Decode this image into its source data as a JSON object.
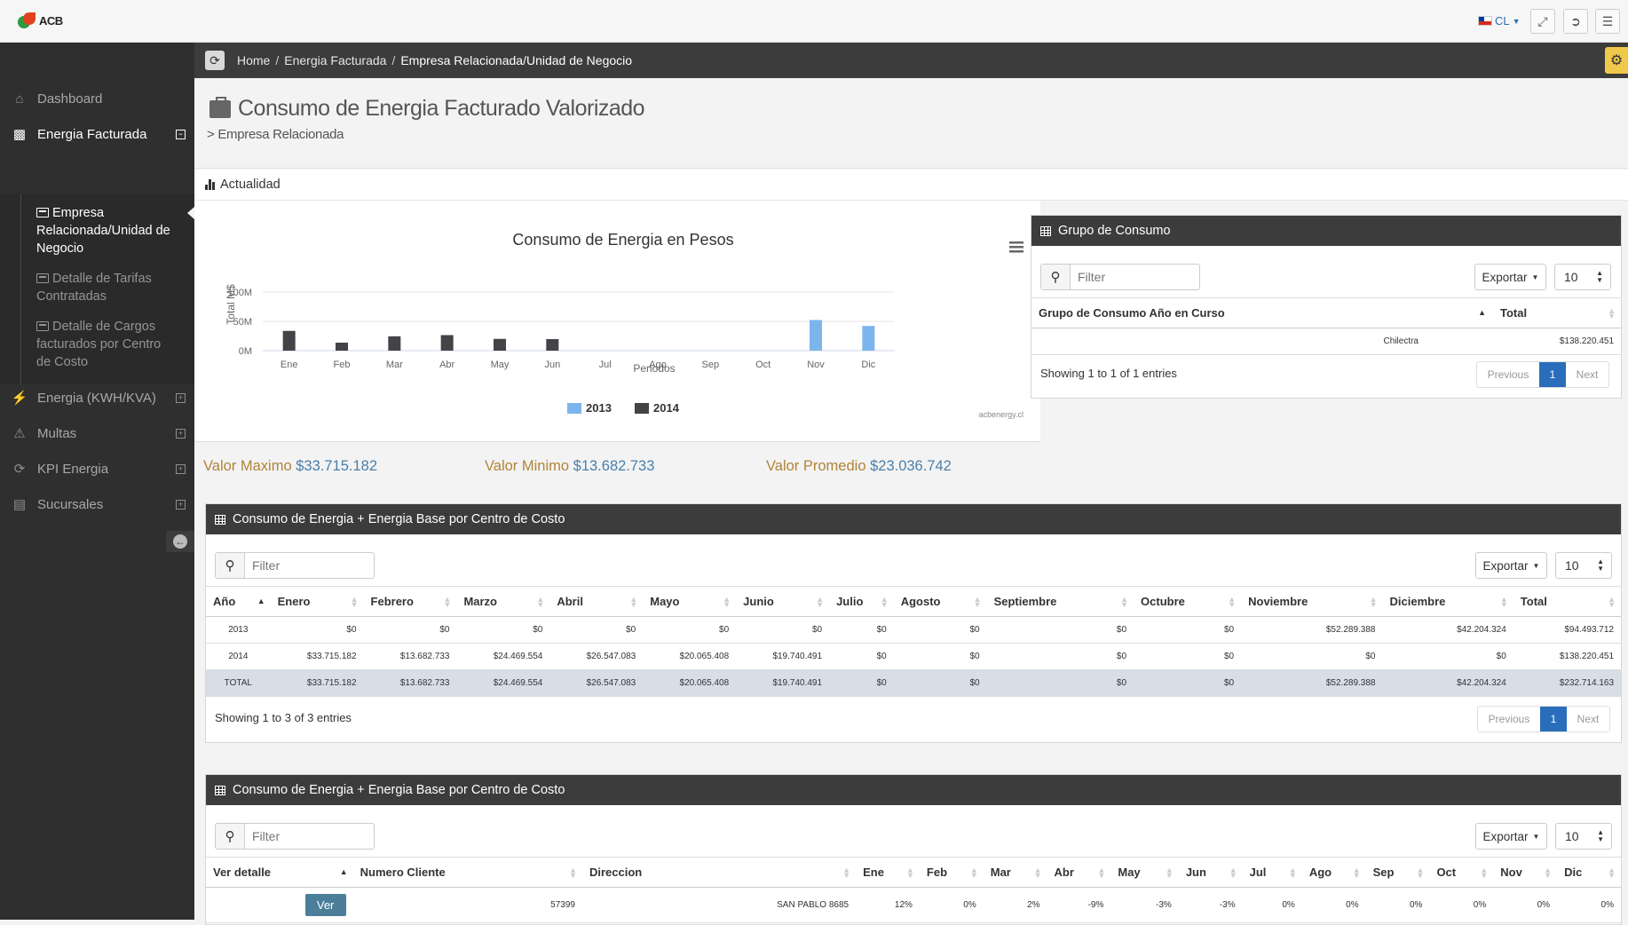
{
  "topbar": {
    "logo_text": "ACB",
    "lang": "CL"
  },
  "breadcrumb": [
    "Home",
    "Energia Facturada",
    "Empresa Relacionada/Unidad de Negocio"
  ],
  "sidebar": {
    "items": [
      {
        "label": "Dashboard",
        "icon": "home-icon"
      },
      {
        "label": "Energia Facturada",
        "icon": "bar-chart-icon"
      },
      {
        "label": "Energia (KWH/KVA)",
        "icon": "bolt-icon"
      },
      {
        "label": "Multas",
        "icon": "warning-icon"
      },
      {
        "label": "KPI Energia",
        "icon": "share-icon"
      },
      {
        "label": "Sucursales",
        "icon": "file-icon"
      }
    ],
    "subitems": [
      {
        "label": "Empresa Relacionada/Unidad de Negocio"
      },
      {
        "label": "Detalle de Tarifas Contratadas"
      },
      {
        "label": "Detalle de Cargos facturados por Centro de Costo"
      }
    ]
  },
  "header": {
    "title": "Consumo de Energia Facturado Valorizado",
    "subtitle": "> Empresa Relacionada"
  },
  "section_label": "Actualidad",
  "chart_data": {
    "type": "bar",
    "title": "Consumo de Energia en Pesos",
    "xlabel": "Periodos",
    "ylabel": "Total M$",
    "categories": [
      "Ene",
      "Feb",
      "Mar",
      "Abr",
      "May",
      "Jun",
      "Jul",
      "Ago",
      "Sep",
      "Oct",
      "Nov",
      "Dic"
    ],
    "yticks": [
      "0M",
      "50M",
      "100M"
    ],
    "ylim": [
      0,
      100
    ],
    "series": [
      {
        "name": "2013",
        "color": "#7cb5ec",
        "values": [
          0,
          0,
          0,
          0,
          0,
          0,
          0,
          0,
          0,
          0,
          52.289388,
          42.204324
        ]
      },
      {
        "name": "2014",
        "color": "#434348",
        "values": [
          33.715182,
          13.682733,
          24.469554,
          26.547083,
          20.065408,
          19.740491,
          0,
          0,
          0,
          0,
          0,
          0
        ]
      }
    ],
    "credit": "acbenergy.cl",
    "grid": true,
    "legend": "bottom-center"
  },
  "stats": [
    {
      "label": "Valor Maximo",
      "value": "$33.715.182"
    },
    {
      "label": "Valor Minimo",
      "value": "$13.682.733"
    },
    {
      "label": "Valor Promedio",
      "value": "$23.036.742"
    }
  ],
  "grupo": {
    "title": "Grupo de Consumo",
    "filter_placeholder": "Filter",
    "export": "Exportar",
    "page_size": "10",
    "columns": [
      "Grupo de Consumo Año en Curso",
      "Total"
    ],
    "rows": [
      [
        "Chilectra",
        "$138.220.451"
      ]
    ],
    "info": "Showing 1 to 1 of 1 entries",
    "pager": {
      "prev": "Previous",
      "page": "1",
      "next": "Next"
    }
  },
  "tabla1": {
    "title": "Consumo de Energia + Energia Base por Centro de Costo",
    "filter_placeholder": "Filter",
    "export": "Exportar",
    "page_size": "10",
    "columns": [
      "Año",
      "Enero",
      "Febrero",
      "Marzo",
      "Abril",
      "Mayo",
      "Junio",
      "Julio",
      "Agosto",
      "Septiembre",
      "Octubre",
      "Noviembre",
      "Diciembre",
      "Total"
    ],
    "rows": [
      [
        "2013",
        "$0",
        "$0",
        "$0",
        "$0",
        "$0",
        "$0",
        "$0",
        "$0",
        "$0",
        "$0",
        "$52.289.388",
        "$42.204.324",
        "$94.493.712"
      ],
      [
        "2014",
        "$33.715.182",
        "$13.682.733",
        "$24.469.554",
        "$26.547.083",
        "$20.065.408",
        "$19.740.491",
        "$0",
        "$0",
        "$0",
        "$0",
        "$0",
        "$0",
        "$138.220.451"
      ],
      [
        "TOTAL",
        "$33.715.182",
        "$13.682.733",
        "$24.469.554",
        "$26.547.083",
        "$20.065.408",
        "$19.740.491",
        "$0",
        "$0",
        "$0",
        "$0",
        "$52.289.388",
        "$42.204.324",
        "$232.714.163"
      ]
    ],
    "info": "Showing 1 to 3 of 3 entries",
    "pager": {
      "prev": "Previous",
      "page": "1",
      "next": "Next"
    }
  },
  "tabla2": {
    "title": "Consumo de Energia + Energia Base por Centro de Costo",
    "filter_placeholder": "Filter",
    "export": "Exportar",
    "page_size": "10",
    "columns": [
      "Ver detalle",
      "Numero Cliente",
      "Direccion",
      "Ene",
      "Feb",
      "Mar",
      "Abr",
      "May",
      "Jun",
      "Jul",
      "Ago",
      "Sep",
      "Oct",
      "Nov",
      "Dic"
    ],
    "rows": [
      {
        "ver": "Ver",
        "cliente": "57399",
        "direccion": "SAN PABLO 8685",
        "vals": [
          "12%",
          "0%",
          "2%",
          "-9%",
          "-3%",
          "-3%",
          "0%",
          "0%",
          "0%",
          "0%",
          "0%",
          "0%"
        ]
      }
    ]
  }
}
